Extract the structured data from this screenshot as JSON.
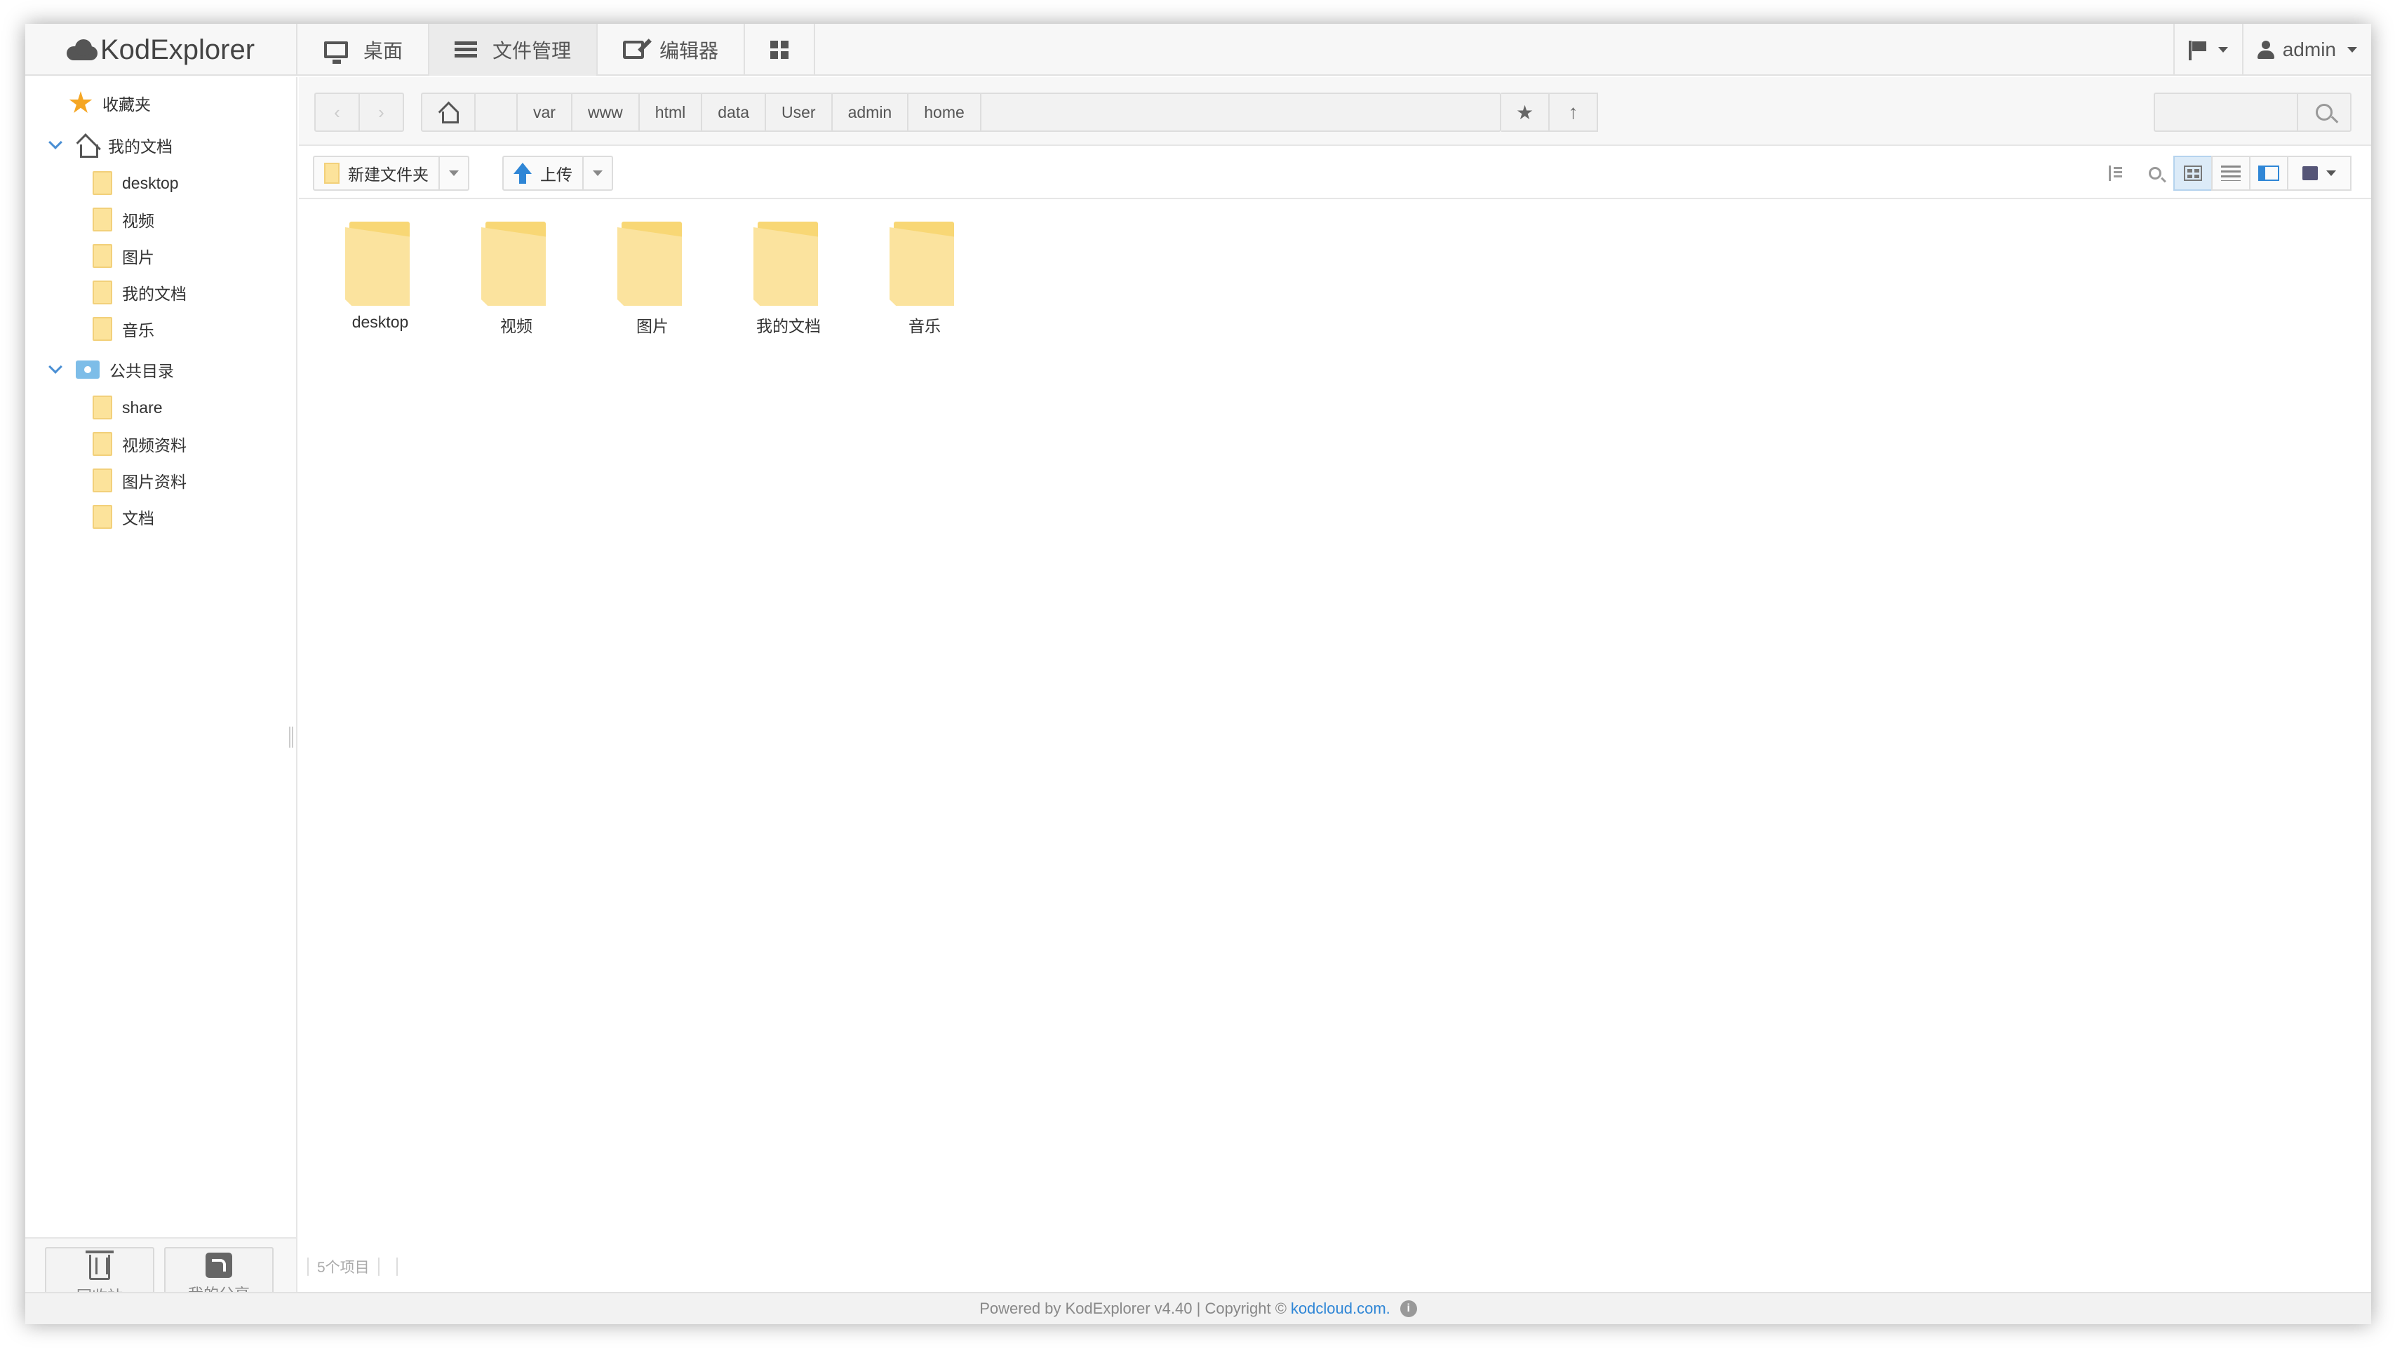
{
  "app": {
    "logo_text": "KodExplorer"
  },
  "nav": {
    "tabs": [
      {
        "label": "桌面",
        "icon": "monitor-icon"
      },
      {
        "label": "文件管理",
        "icon": "list-icon",
        "active": true
      },
      {
        "label": "编辑器",
        "icon": "edit-icon"
      },
      {
        "label": "",
        "icon": "grid-icon"
      }
    ],
    "user": "admin"
  },
  "sidebar": {
    "favorites": "收藏夹",
    "my_docs": {
      "label": "我的文档",
      "children": [
        "desktop",
        "视频",
        "图片",
        "我的文档",
        "音乐"
      ]
    },
    "public": {
      "label": "公共目录",
      "children": [
        "share",
        "视频资料",
        "图片资料",
        "文档"
      ]
    },
    "recycle_label": "回收站",
    "share_label": "我的分享"
  },
  "address": {
    "back": "‹",
    "forward": "›",
    "crumbs": [
      "var",
      "www",
      "html",
      "data",
      "User",
      "admin",
      "home"
    ],
    "search_placeholder": ""
  },
  "toolbar": {
    "new_folder": "新建文件夹",
    "upload": "上传"
  },
  "files": [
    {
      "name": "desktop",
      "type": "folder"
    },
    {
      "name": "视频",
      "type": "folder"
    },
    {
      "name": "图片",
      "type": "folder"
    },
    {
      "name": "我的文档",
      "type": "folder"
    },
    {
      "name": "音乐",
      "type": "folder"
    }
  ],
  "status": {
    "count": "5个项目"
  },
  "footer": {
    "text": "Powered by KodExplorer v4.40 | Copyright ©",
    "link": "kodcloud.com.",
    "info": "i"
  },
  "colors": {
    "accent": "#2f86d6",
    "folder": "#fbe39e",
    "star": "#f5a623"
  }
}
